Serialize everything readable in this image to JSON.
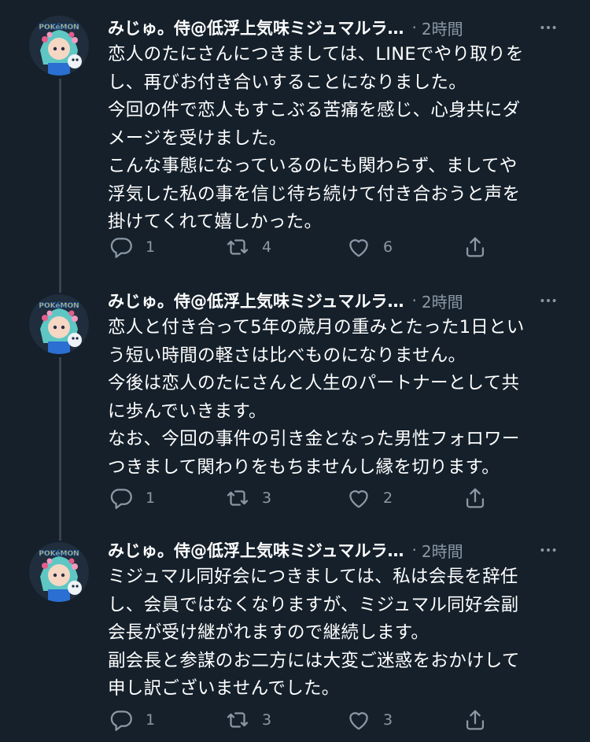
{
  "tweets": [
    {
      "name": "みじゅ。侍@低浮上気味ミジュマルラ…",
      "separator": "·",
      "time": "2時間",
      "lines": [
        "恋人のたにさんにつきましては、LINEでやり取りを",
        "し、再びお付き合いすることになりました。",
        "今回の件で恋人もすこぶる苦痛を感じ、心身共にダ",
        "メージを受けました。",
        "こんな事態になっているのにも関わらず、ましてや",
        "浮気した私の事を信じ待ち続けて付き合おうと声を",
        "掛けてくれて嬉しかった。"
      ],
      "replies": "1",
      "retweets": "4",
      "likes": "6"
    },
    {
      "name": "みじゅ。侍@低浮上気味ミジュマルラ…",
      "separator": "·",
      "time": "2時間",
      "lines": [
        "恋人と付き合って5年の歳月の重みとたった1日とい",
        "う短い時間の軽さは比べものになりません。",
        "今後は恋人のたにさんと人生のパートナーとして共",
        "に歩んでいきます。",
        "なお、今回の事件の引き金となった男性フォロワー",
        "つきまして関わりをもちませんし縁を切ります。"
      ],
      "replies": "1",
      "retweets": "3",
      "likes": "2"
    },
    {
      "name": "みじゅ。侍@低浮上気味ミジュマルラ…",
      "separator": "·",
      "time": "2時間",
      "lines": [
        "ミジュマル同好会につきましては、私は会長を辞任",
        "し、会員ではなくなりますが、ミジュマル同好会副",
        "会長が受け継がれますので継続します。",
        "副会長と参謀のお二方には大変ご迷惑をおかけして",
        "申し訳ございませんでした。"
      ],
      "replies": "1",
      "retweets": "3",
      "likes": "3"
    }
  ],
  "avatar_logo_text": "POKéMON",
  "icons": {
    "reply": "reply-icon",
    "retweet": "retweet-icon",
    "like": "heart-icon",
    "share": "share-icon",
    "more": "more-icon"
  },
  "colors": {
    "background": "#15202b",
    "text": "#ffffff",
    "secondary": "#8b98a5",
    "thread_line": "#38444d"
  }
}
